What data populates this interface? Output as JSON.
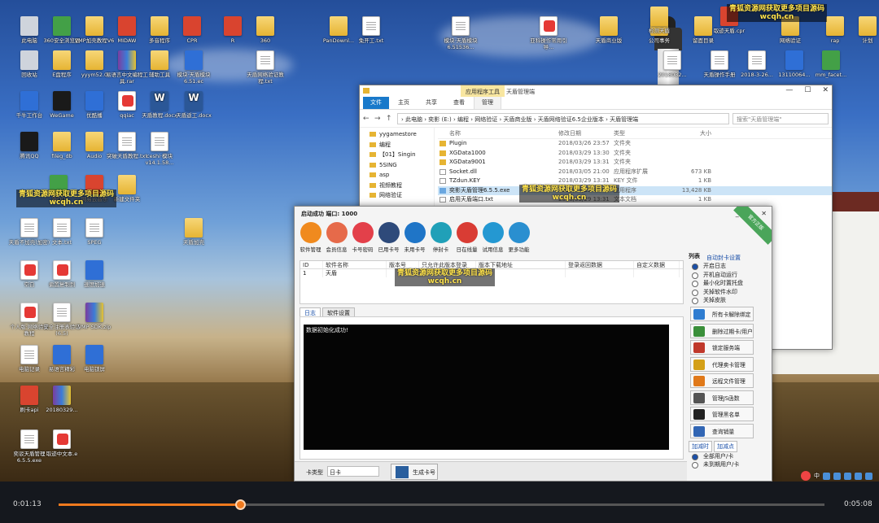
{
  "desktop": {
    "icons": [
      {
        "label": "此电脑",
        "type": "gray"
      },
      {
        "label": "360安全浏览器",
        "type": "green"
      },
      {
        "label": "VMP加壳教程V6",
        "type": "folder"
      },
      {
        "label": "MIDAW",
        "type": "red"
      },
      {
        "label": "多音程序",
        "type": "folder"
      },
      {
        "label": "CPR",
        "type": "red"
      },
      {
        "label": "R",
        "type": "red"
      },
      {
        "label": "360",
        "type": "folder"
      },
      {
        "label": "PanDownl...",
        "type": "folder"
      },
      {
        "label": "免开工.txt",
        "type": "doc"
      },
      {
        "label": "模块·天盾模块6.51536...",
        "type": "doc"
      },
      {
        "label": "亚科操作常用引导...",
        "type": "pdf"
      },
      {
        "label": "天盾商业版",
        "type": "folder"
      },
      {
        "label": "公司事务",
        "type": "folder"
      },
      {
        "label": "留面目录",
        "type": "folder"
      },
      {
        "label": "回收站",
        "type": "gray"
      },
      {
        "label": "E盘程序",
        "type": "folder"
      },
      {
        "label": "yyym52.0",
        "type": "folder"
      },
      {
        "label": "易语言中文编程工具.rar",
        "type": "rar"
      },
      {
        "label": "辅助工具",
        "type": "folder"
      },
      {
        "label": "模块·天盾模块6.51.ec",
        "type": "blue"
      },
      {
        "label": "天盾网络验证教程.txt",
        "type": "doc"
      },
      {
        "label": "千牛工作台",
        "type": "blue"
      },
      {
        "label": "WeGame",
        "type": "black"
      },
      {
        "label": "优酷播",
        "type": "blue"
      },
      {
        "label": "qqiac",
        "type": "pdf"
      },
      {
        "label": "天盾教程.docx",
        "type": "word"
      },
      {
        "label": "天盾返工.docx",
        "type": "word"
      },
      {
        "label": "腾讯QQ",
        "type": "black"
      },
      {
        "label": "fileg_db",
        "type": "folder"
      },
      {
        "label": "Audio",
        "type": "folder"
      },
      {
        "label": "突破天盾教程.txt",
        "type": "doc"
      },
      {
        "label": "ceshi·模块v14.1.58...",
        "type": "doc"
      },
      {
        "label": "新QQ",
        "type": "green"
      },
      {
        "label": "网易云音乐",
        "type": "red"
      },
      {
        "label": "新建文件夹",
        "type": "folder"
      },
      {
        "label": "天盾加壳",
        "type": "folder"
      },
      {
        "label": "天盾不加壳(加密)",
        "type": "doc"
      },
      {
        "label": "文本.txt",
        "type": "doc"
      },
      {
        "label": "SPEG",
        "type": "doc"
      },
      {
        "label": "空白",
        "type": "pdf"
      },
      {
        "label": "偏置复制到",
        "type": "pdf"
      },
      {
        "label": "速度加速",
        "type": "blue"
      },
      {
        "label": "个人版·网络验证教程",
        "type": "pdf"
      },
      {
        "label": "安全注册表验证(6.5)",
        "type": "doc"
      },
      {
        "label": "VMP SDK.zip",
        "type": "rar"
      },
      {
        "label": "电脑记录",
        "type": "doc"
      },
      {
        "label": "易语言精彩",
        "type": "blue"
      },
      {
        "label": "电脑锁屏",
        "type": "blue"
      },
      {
        "label": "刷卡api",
        "type": "red"
      },
      {
        "label": "20180329...",
        "type": "rar"
      },
      {
        "label": "奕驳天盾管理6.5.5.exe",
        "type": "doc"
      },
      {
        "label": "取迹中文本.e",
        "type": "pdf"
      },
      {
        "label": "网络验证",
        "type": "folder"
      },
      {
        "label": "rap",
        "type": "folder"
      },
      {
        "label": "计划",
        "type": "folder"
      },
      {
        "label": "2018032...",
        "type": "doc"
      },
      {
        "label": "天盾操作手册",
        "type": "doc"
      },
      {
        "label": "2018-3-26...",
        "type": "doc"
      },
      {
        "label": "13110064...",
        "type": "blue"
      },
      {
        "label": "mm_facet...",
        "type": "green"
      },
      {
        "label": "检测天盾",
        "type": "folder"
      },
      {
        "label": "取迹天盾.cpr",
        "type": "red"
      }
    ],
    "watermark": {
      "line1": "青狐资源网获取更多项目源码",
      "line2": "wcqh.cn"
    }
  },
  "explorer": {
    "context_tab": "应用程序工具",
    "window_title": "天盾管理端",
    "ribbon_tabs": [
      "文件",
      "主页",
      "共享",
      "查看",
      "管理"
    ],
    "address": "› 此电脑 › 奕影 (E:) › 编程 › 网络验证 › 天盾商业版 › 天盾网络验证6.5企业版本 › 天盾管理端",
    "search_placeholder": "搜索\"天盾管理端\"",
    "tree": [
      "yygamestore",
      "编程",
      "【01】Singin",
      "5SING",
      "asp",
      "视频教程",
      "网络验证"
    ],
    "columns": [
      "名称",
      "修改日期",
      "类型",
      "大小"
    ],
    "files": [
      {
        "name": "Plugin",
        "date": "2018/03/26 23:57",
        "type": "文件夹",
        "size": "",
        "icon": "folder"
      },
      {
        "name": "XGData1000",
        "date": "2018/03/29 13:30",
        "type": "文件夹",
        "size": "",
        "icon": "folder"
      },
      {
        "name": "XGData9001",
        "date": "2018/03/29 13:31",
        "type": "文件夹",
        "size": "",
        "icon": "folder"
      },
      {
        "name": "Socket.dll",
        "date": "2018/03/05 21:00",
        "type": "应用程序扩展",
        "size": "673 KB",
        "icon": "file"
      },
      {
        "name": "TZdun.KEY",
        "date": "2018/03/29 13:31",
        "type": "KEY 文件",
        "size": "1 KB",
        "icon": "file"
      },
      {
        "name": "奕影天盾管理6.5.5.exe",
        "date": "2018/03/29 15:36",
        "type": "应用程序",
        "size": "13,428 KB",
        "icon": "exe",
        "selected": true
      },
      {
        "name": "启用天盾端口.txt",
        "date": "2018/03/29 13:31",
        "type": "文本文档",
        "size": "1 KB",
        "icon": "file"
      }
    ]
  },
  "app": {
    "title": "启动成功  端口: 1000",
    "badge": "官方正版",
    "tools": [
      {
        "label": "软件管理",
        "color": "#f08a1e"
      },
      {
        "label": "会员信息",
        "color": "#e66a4a"
      },
      {
        "label": "卡号密码",
        "color": "#e3404a"
      },
      {
        "label": "已用卡号",
        "color": "#2e4a7a"
      },
      {
        "label": "未用卡号",
        "color": "#1f75c7"
      },
      {
        "label": "停封卡",
        "color": "#20a0b8"
      },
      {
        "label": "日在线量",
        "color": "#d93c34"
      },
      {
        "label": "试用信息",
        "color": "#2498d2"
      },
      {
        "label": "更多功能",
        "color": "#2a8fd0"
      }
    ],
    "grid_columns": [
      "ID",
      "软件名称",
      "版本号",
      "只允许此版本登录",
      "版本下载地址",
      "登录返回数据",
      "自定义数据"
    ],
    "grid_rows": [
      [
        "1",
        "天盾",
        "",
        "",
        "",
        "",
        ""
      ]
    ],
    "log_tabs": [
      "日志",
      "软件设置"
    ],
    "log_text": "数据初始化成功!",
    "side_header": "列表",
    "side_section": "自动封卡设置",
    "options": [
      {
        "label": "开启日志",
        "on": true
      },
      {
        "label": "开机自动运行",
        "on": false
      },
      {
        "label": "最小化时置托盘",
        "on": false
      },
      {
        "label": "关掉软件水印",
        "on": false
      },
      {
        "label": "关掉皮肤",
        "on": false
      }
    ],
    "side_buttons": [
      {
        "label": "所有卡解除绑定",
        "color": "#2f7dd1"
      },
      {
        "label": "删除过期卡/用户",
        "color": "#3a8f3a"
      },
      {
        "label": "锁定服务端",
        "color": "#c0392b"
      },
      {
        "label": "代理卖卡管理",
        "color": "#d4a017"
      },
      {
        "label": "远程文件管理",
        "color": "#e0791a"
      },
      {
        "label": "管理JS函数",
        "color": "#555"
      },
      {
        "label": "管理黑名单",
        "color": "#222"
      },
      {
        "label": "查询销量",
        "color": "#3266b4"
      }
    ],
    "bottom_tabs": [
      "加减时",
      "加减点"
    ],
    "bottom_options": [
      {
        "label": "全部用户/卡",
        "on": true
      },
      {
        "label": "未到期用户/卡",
        "on": false
      }
    ],
    "bottom_bar": {
      "label": "卡类型",
      "select": "日卡",
      "button": "生成卡号"
    }
  },
  "player": {
    "current": "0:01:13",
    "total": "0:05:08",
    "progress": 0.237
  }
}
